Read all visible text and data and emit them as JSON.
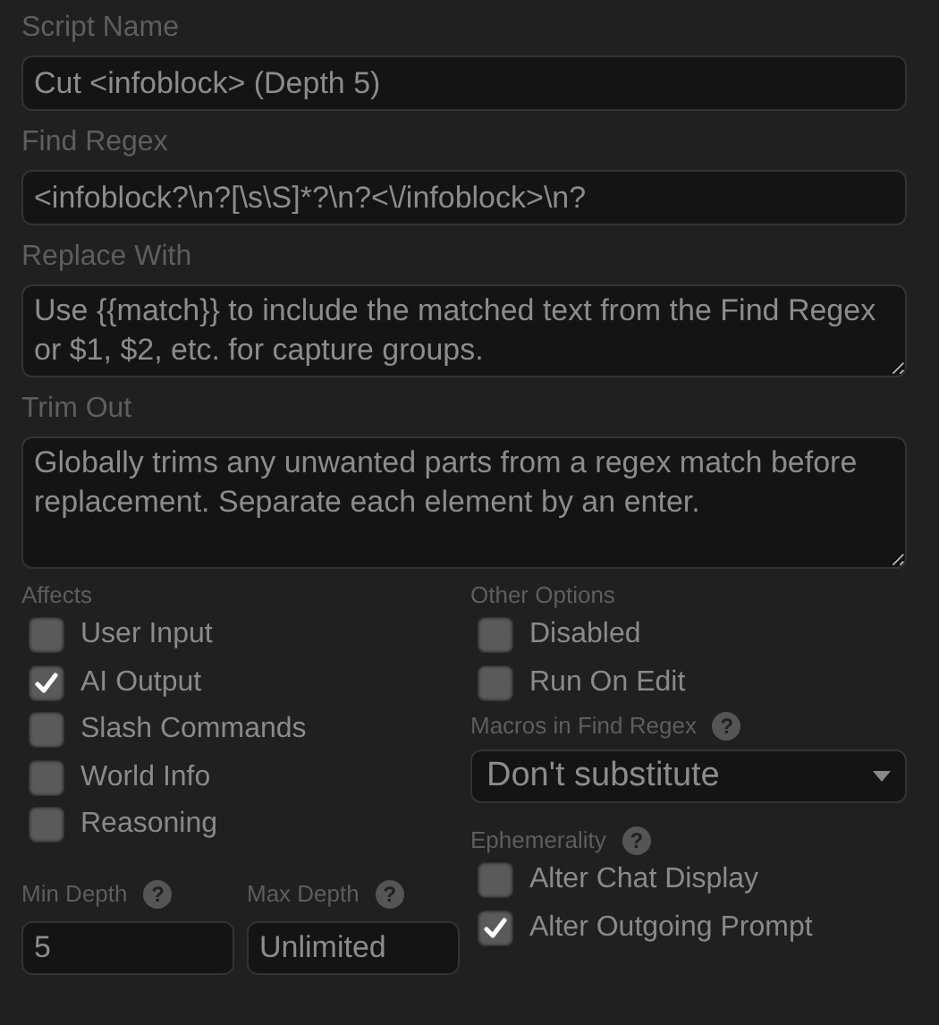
{
  "fields": [
    {
      "label": "Script Name",
      "kind": "input",
      "value": "Cut <infoblock> (Depth 5)"
    },
    {
      "label": "Find Regex",
      "kind": "input",
      "value": "<infoblock?\\n?[\\s\\S]*?\\n?<\\/infoblock>\\n?"
    },
    {
      "label": "Replace With",
      "kind": "textarea",
      "placeholder": "Use {{match}} to include the matched text from the Find Regex or $1, $2, etc. for capture groups."
    },
    {
      "label": "Trim Out",
      "kind": "textarea",
      "placeholder": "Globally trims any unwanted parts from a regex match before replacement. Separate each element by an enter."
    }
  ],
  "affects": {
    "label": "Affects",
    "options": [
      {
        "label": "User Input",
        "checked": false
      },
      {
        "label": "AI Output",
        "checked": true
      },
      {
        "label": "Slash Commands",
        "checked": false
      },
      {
        "label": "World Info",
        "checked": false
      },
      {
        "label": "Reasoning",
        "checked": false
      }
    ]
  },
  "depth": [
    {
      "label": "Min Depth",
      "hint": "?",
      "value": "5"
    },
    {
      "label": "Max Depth",
      "hint": "?",
      "placeholder": "Unlimited"
    }
  ],
  "other_options": {
    "label": "Other Options",
    "options": [
      {
        "label": "Disabled",
        "checked": false
      },
      {
        "label": "Run On Edit",
        "checked": false
      }
    ]
  },
  "macros": {
    "label": "Macros in Find Regex",
    "hint": "?",
    "value": "Don't substitute"
  },
  "ephemerality": {
    "label": "Ephemerality",
    "hint": "?",
    "options": [
      {
        "label": "Alter Chat Display",
        "checked": false
      },
      {
        "label": "Alter Outgoing Prompt",
        "checked": true
      }
    ]
  }
}
